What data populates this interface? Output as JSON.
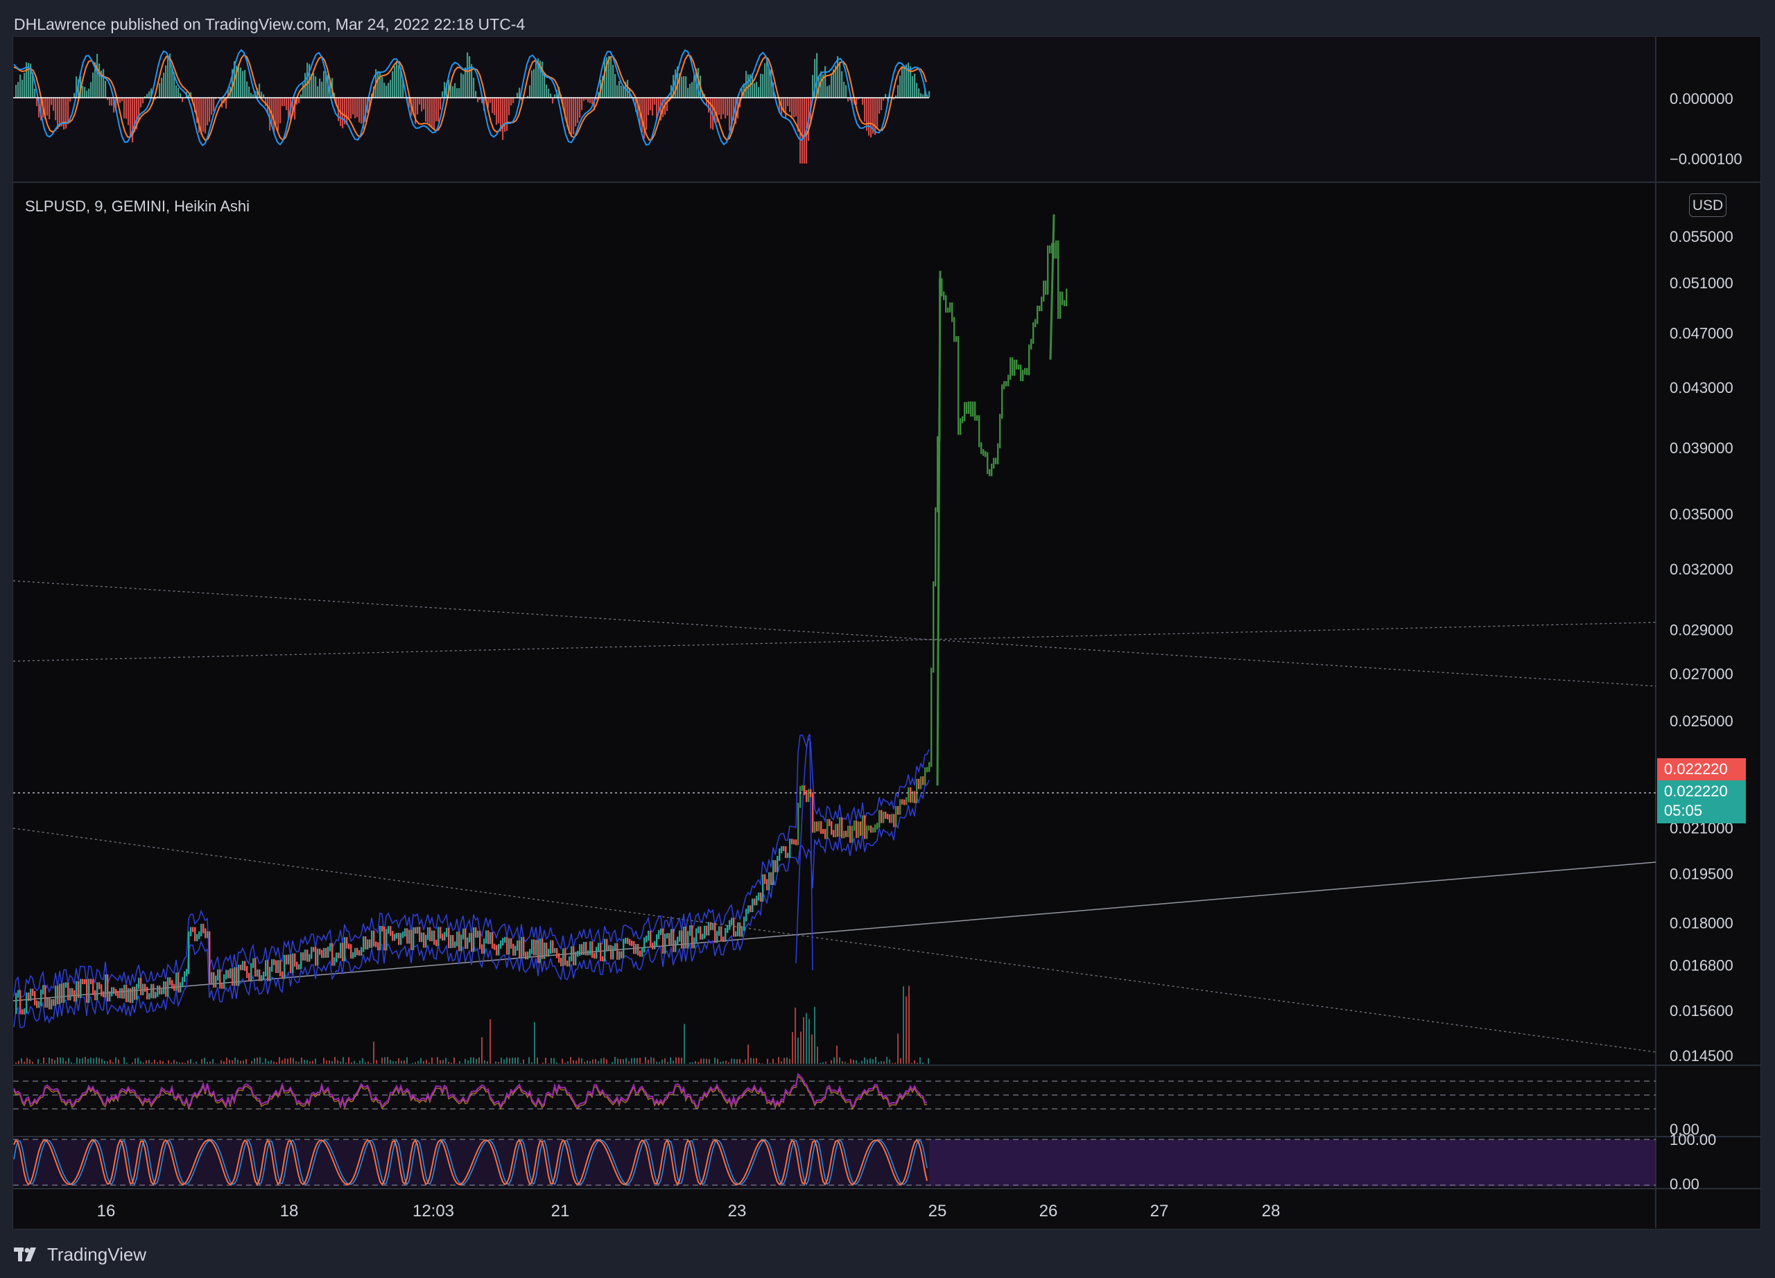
{
  "header": {
    "published_text": "DHLawrence published on TradingView.com, Mar 24, 2022 22:18 UTC-4"
  },
  "main_chart": {
    "legend": "SLPUSD, 9, GEMINI, Heikin Ashi",
    "currency": "USD",
    "price_labels": [
      "0.055000",
      "0.051000",
      "0.047000",
      "0.043000",
      "0.039000",
      "0.035000",
      "0.032000",
      "0.029000",
      "0.027000",
      "0.025000",
      "0.021000",
      "0.019500",
      "0.018000",
      "0.016800",
      "0.015600",
      "0.014500"
    ],
    "last_price_red": "0.022220",
    "last_price_teal": "0.022220",
    "countdown": "05:05"
  },
  "oscillator_top": {
    "labels": [
      "0.000000",
      "−0.000100"
    ]
  },
  "rsi_panel": {
    "labels": [
      "0.00"
    ]
  },
  "stoch_panel": {
    "labels": [
      "100.00",
      "0.00"
    ]
  },
  "time_axis": {
    "labels": [
      "16",
      "18",
      "12:03",
      "21",
      "23",
      "25",
      "26",
      "27",
      "28"
    ]
  },
  "brand": {
    "name": "TradingView"
  },
  "colors": {
    "background": "#0c0c0f",
    "candle_green": "#3d8b3d",
    "candle_teal": "#26a69a",
    "candle_red": "#ef5350",
    "bb_line": "#2f3fd8",
    "trend_line": "#9598a1",
    "macd_blue": "#2196f3",
    "macd_orange": "#ff7f27",
    "rsi_purple": "#9c27b0",
    "stoch_orange": "#ff6e40",
    "stoch_bg": "#2a1745"
  },
  "chart_data": [
    {
      "type": "line",
      "title": "SLPUSD, 9, GEMINI, Heikin Ashi",
      "x": [
        "16",
        "17",
        "18",
        "19",
        "20",
        "21",
        "22",
        "23",
        "23.5",
        "24",
        "24.5",
        "25",
        "25.3",
        "25.6",
        "26",
        "26.1"
      ],
      "series": [
        {
          "values": [
            0.016,
            0.0164,
            0.0168,
            0.0176,
            0.0175,
            0.0171,
            0.0174,
            0.0178,
            0.0212,
            0.0209,
            0.0213,
            0.023,
            0.051,
            0.039,
            0.043,
            0.0495
          ]
        }
      ],
      "ylim": [
        0.0145,
        0.057
      ],
      "y_scale": "log",
      "current_price": 0.02222
    }
  ]
}
